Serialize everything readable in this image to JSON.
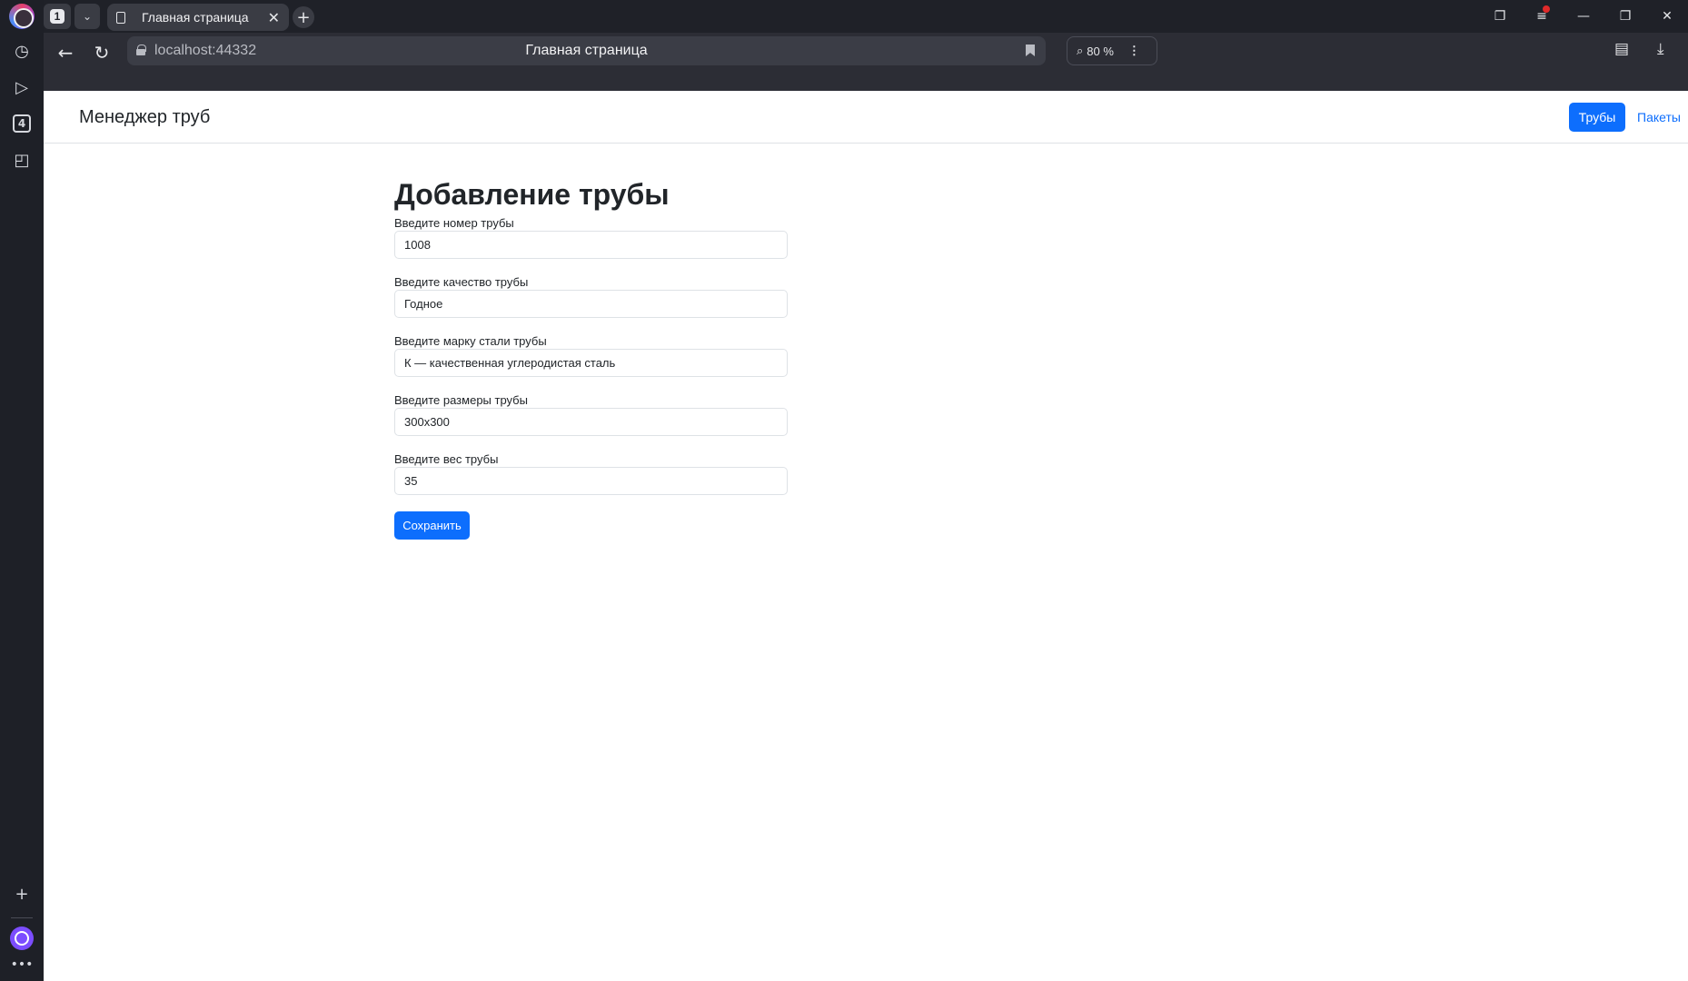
{
  "browser": {
    "tab_count": "1",
    "tab_title": "Главная страница",
    "url": "localhost:44332",
    "page_title": "Главная страница",
    "zoom": "80 %",
    "sidebar_badge": "4"
  },
  "navbar": {
    "brand": "Менеджер труб",
    "links": [
      {
        "label": "Трубы",
        "active": true
      },
      {
        "label": "Пакеты",
        "active": false
      }
    ]
  },
  "form": {
    "title": "Добавление трубы",
    "fields": [
      {
        "label": "Введите номер трубы",
        "value": "1008"
      },
      {
        "label": "Введите качество трубы",
        "value": "Годное"
      },
      {
        "label": "Введите марку стали трубы",
        "value": "К — качественная углеродистая сталь"
      },
      {
        "label": "Введите размеры трубы",
        "value": "300x300"
      },
      {
        "label": "Введите вес трубы",
        "value": "35"
      }
    ],
    "submit_label": "Сохранить"
  },
  "colors": {
    "primary": "#0d6efd",
    "browser_dark": "#1f2128"
  }
}
